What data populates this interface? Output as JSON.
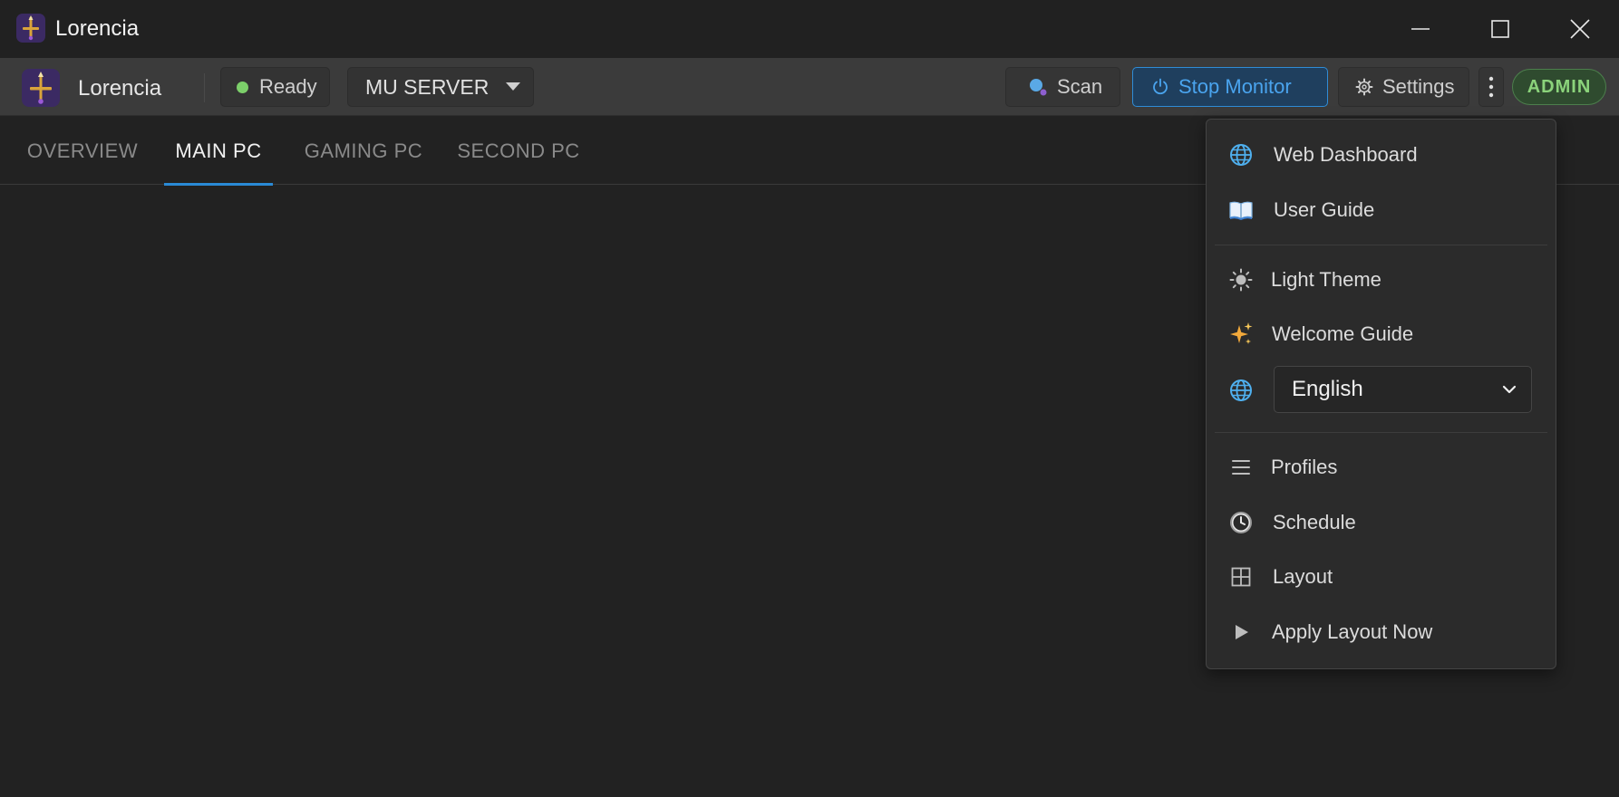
{
  "window": {
    "title": "Lorencia",
    "controls": [
      "minimize",
      "maximize",
      "close"
    ]
  },
  "toolbar": {
    "app_name": "Lorencia",
    "status_label": "Ready",
    "server_selected": "MU SERVER",
    "scan_label": "Scan",
    "stop_monitor_label": "Stop Monitor",
    "settings_label": "Settings",
    "admin_badge": "ADMIN"
  },
  "tabs": [
    {
      "label": "OVERVIEW",
      "active": false
    },
    {
      "label": "MAIN PC",
      "active": true
    },
    {
      "label": "GAMING PC",
      "active": false
    },
    {
      "label": "SECOND PC",
      "active": false
    }
  ],
  "menu": {
    "web_dashboard": "Web Dashboard",
    "user_guide": "User Guide",
    "light_theme": "Light Theme",
    "welcome_guide": "Welcome Guide",
    "language_selected": "English",
    "profiles": "Profiles",
    "schedule": "Schedule",
    "layout": "Layout",
    "apply_layout_now": "Apply Layout Now"
  },
  "colors": {
    "accent_blue": "#2a8ad6",
    "status_green": "#7ccf6a",
    "admin_green": "#8bd37b",
    "background": "#222222"
  }
}
